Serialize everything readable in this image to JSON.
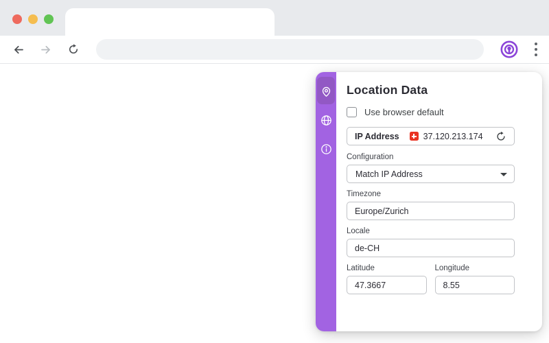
{
  "theme": {
    "chrome_gray": "#e8eaed",
    "urlbar_gray": "#f0f2f4",
    "light_red": "#ee6a5e",
    "light_yellow": "#f5bd4f",
    "light_green": "#61c454",
    "sidebar_purple": "#a263e2",
    "sidebar_active": "#9258c4",
    "extension_purple": "#8b44d8",
    "flag_red": "#e93323",
    "text_dark": "#2b2b33",
    "label_gray": "#3f4249",
    "border_gray": "#c1c3c7"
  },
  "browser": {
    "tab_title": "",
    "url_value": ""
  },
  "sidebar": {
    "items": [
      {
        "icon": "location-pin-icon",
        "active": true
      },
      {
        "icon": "globe-icon",
        "active": false
      },
      {
        "icon": "info-icon",
        "active": false
      }
    ]
  },
  "panel": {
    "title": "Location Data",
    "browser_default": {
      "label": "Use browser default",
      "checked": false
    },
    "ip": {
      "label": "IP Address",
      "value": "37.120.213.174",
      "country_flag": "swiss-flag"
    },
    "configuration": {
      "label": "Configuration",
      "value": "Match IP Address"
    },
    "timezone": {
      "label": "Timezone",
      "value": "Europe/Zurich"
    },
    "locale": {
      "label": "Locale",
      "value": "de-CH"
    },
    "latitude": {
      "label": "Latitude",
      "value": "47.3667"
    },
    "longitude": {
      "label": "Longitude",
      "value": "8.55"
    }
  }
}
